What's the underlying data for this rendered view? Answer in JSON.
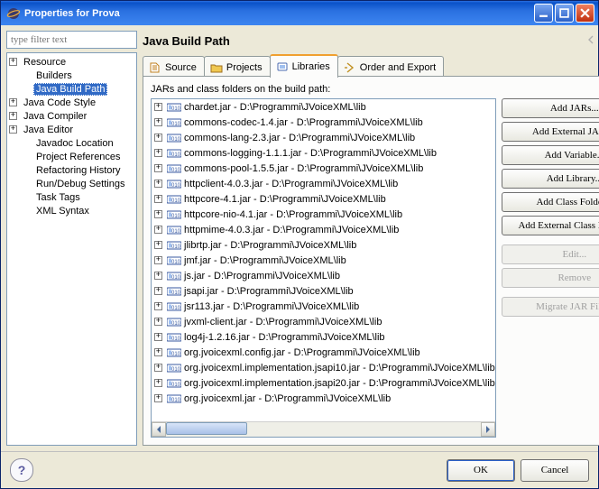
{
  "window": {
    "title": "Properties for Prova"
  },
  "filter": {
    "placeholder": "type filter text"
  },
  "tree": [
    {
      "label": "Resource",
      "expandable": true,
      "depth": 0
    },
    {
      "label": "Builders",
      "expandable": false,
      "depth": 1
    },
    {
      "label": "Java Build Path",
      "expandable": false,
      "depth": 1,
      "selected": true
    },
    {
      "label": "Java Code Style",
      "expandable": true,
      "depth": 0
    },
    {
      "label": "Java Compiler",
      "expandable": true,
      "depth": 0
    },
    {
      "label": "Java Editor",
      "expandable": true,
      "depth": 0
    },
    {
      "label": "Javadoc Location",
      "expandable": false,
      "depth": 1
    },
    {
      "label": "Project References",
      "expandable": false,
      "depth": 1
    },
    {
      "label": "Refactoring History",
      "expandable": false,
      "depth": 1
    },
    {
      "label": "Run/Debug Settings",
      "expandable": false,
      "depth": 1
    },
    {
      "label": "Task Tags",
      "expandable": false,
      "depth": 1
    },
    {
      "label": "XML Syntax",
      "expandable": false,
      "depth": 1
    }
  ],
  "page": {
    "title": "Java Build Path"
  },
  "tabs": [
    {
      "label": "Source"
    },
    {
      "label": "Projects"
    },
    {
      "label": "Libraries",
      "active": true
    },
    {
      "label": "Order and Export"
    }
  ],
  "libraries_caption": "JARs and class folders on the build path:",
  "jars": [
    "chardet.jar - D:\\Programmi\\JVoiceXML\\lib",
    "commons-codec-1.4.jar - D:\\Programmi\\JVoiceXML\\lib",
    "commons-lang-2.3.jar - D:\\Programmi\\JVoiceXML\\lib",
    "commons-logging-1.1.1.jar - D:\\Programmi\\JVoiceXML\\lib",
    "commons-pool-1.5.5.jar - D:\\Programmi\\JVoiceXML\\lib",
    "httpclient-4.0.3.jar - D:\\Programmi\\JVoiceXML\\lib",
    "httpcore-4.1.jar - D:\\Programmi\\JVoiceXML\\lib",
    "httpcore-nio-4.1.jar - D:\\Programmi\\JVoiceXML\\lib",
    "httpmime-4.0.3.jar - D:\\Programmi\\JVoiceXML\\lib",
    "jlibrtp.jar - D:\\Programmi\\JVoiceXML\\lib",
    "jmf.jar - D:\\Programmi\\JVoiceXML\\lib",
    "js.jar - D:\\Programmi\\JVoiceXML\\lib",
    "jsapi.jar - D:\\Programmi\\JVoiceXML\\lib",
    "jsr113.jar - D:\\Programmi\\JVoiceXML\\lib",
    "jvxml-client.jar - D:\\Programmi\\JVoiceXML\\lib",
    "log4j-1.2.16.jar - D:\\Programmi\\JVoiceXML\\lib",
    "org.jvoicexml.config.jar - D:\\Programmi\\JVoiceXML\\lib",
    "org.jvoicexml.implementation.jsapi10.jar - D:\\Programmi\\JVoiceXML\\lib",
    "org.jvoicexml.implementation.jsapi20.jar - D:\\Programmi\\JVoiceXML\\lib",
    "org.jvoicexml.jar - D:\\Programmi\\JVoiceXML\\lib"
  ],
  "buttons": {
    "add_jars": "Add JARs...",
    "add_ext_jars": "Add External JARs...",
    "add_var": "Add Variable...",
    "add_lib": "Add Library...",
    "add_class_folder": "Add Class Folder...",
    "add_ext_class_folder": "Add External Class Folder...",
    "edit": "Edit...",
    "remove": "Remove",
    "migrate": "Migrate JAR File..."
  },
  "footer": {
    "ok": "OK",
    "cancel": "Cancel",
    "help": "?"
  }
}
